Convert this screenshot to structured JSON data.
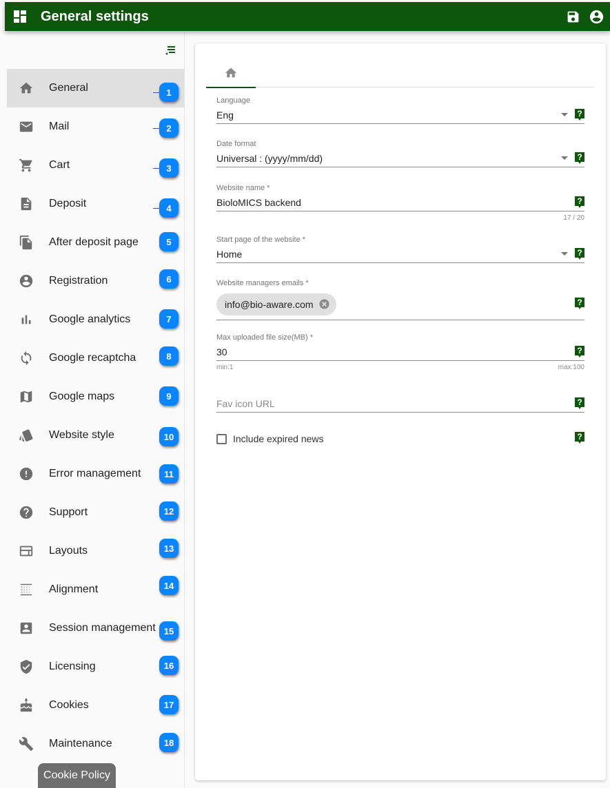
{
  "app": {
    "title": "General settings",
    "colors": {
      "primary": "#0d570c",
      "badge": "#0a84ff",
      "active_item_bg": "#e0e0e0"
    },
    "icons": {
      "menu": "dashboard-icon",
      "save": "save-icon",
      "account": "account-circle-icon",
      "collapse": "menu-open-icon"
    }
  },
  "sidebar": {
    "items": [
      {
        "label": "General",
        "icon": "home-icon",
        "badge": "1",
        "active": true
      },
      {
        "label": "Mail",
        "icon": "mail-icon",
        "badge": "2"
      },
      {
        "label": "Cart",
        "icon": "cart-icon",
        "badge": "3"
      },
      {
        "label": "Deposit",
        "icon": "file-icon",
        "badge": "4"
      },
      {
        "label": "After deposit page",
        "icon": "file-copy-icon",
        "badge": "5"
      },
      {
        "label": "Registration",
        "icon": "account-circle-icon",
        "badge": "6"
      },
      {
        "label": "Google analytics",
        "icon": "bar-chart-icon",
        "badge": "7"
      },
      {
        "label": "Google recaptcha",
        "icon": "sync-icon",
        "badge": "8"
      },
      {
        "label": "Google maps",
        "icon": "map-icon",
        "badge": "9"
      },
      {
        "label": "Website style",
        "icon": "style-icon",
        "badge": "10"
      },
      {
        "label": "Error management",
        "icon": "error-icon",
        "badge": "11"
      },
      {
        "label": "Support",
        "icon": "help-icon",
        "badge": "12"
      },
      {
        "label": "Layouts",
        "icon": "layout-icon",
        "badge": "13"
      },
      {
        "label": "Alignment",
        "icon": "grid-icon",
        "badge": "14"
      },
      {
        "label": "Session management",
        "icon": "account-box-icon",
        "badge": "15"
      },
      {
        "label": "Licensing",
        "icon": "verified-shield-icon",
        "badge": "16"
      },
      {
        "label": "Cookies",
        "icon": "cake-icon",
        "badge": "17"
      },
      {
        "label": "Maintenance",
        "icon": "wrench-icon",
        "badge": "18"
      }
    ]
  },
  "cookie_policy": {
    "label": "Cookie Policy"
  },
  "main": {
    "tabs": [
      {
        "icon": "home-icon",
        "active": true
      }
    ],
    "fields": {
      "language": {
        "label": "Language",
        "value": "Eng"
      },
      "date_format": {
        "label": "Date format",
        "value": "Universal : (yyyy/mm/dd)"
      },
      "website_name": {
        "label": "Website name *",
        "value": "BioloMICS backend",
        "counter": "17 / 20"
      },
      "start_page": {
        "label": "Start page of the website *",
        "value": "Home"
      },
      "manager_emails": {
        "label": "Website managers emails *",
        "chips": [
          "info@bio-aware.com"
        ]
      },
      "max_file_size": {
        "label": "Max uploaded file size(MB) *",
        "value": "30",
        "min_hint": "min:1",
        "max_hint": "max:100"
      },
      "fav_icon": {
        "placeholder": "Fav icon URL",
        "value": ""
      }
    },
    "include_expired_news": {
      "label": "Include expired news",
      "checked": false
    }
  }
}
